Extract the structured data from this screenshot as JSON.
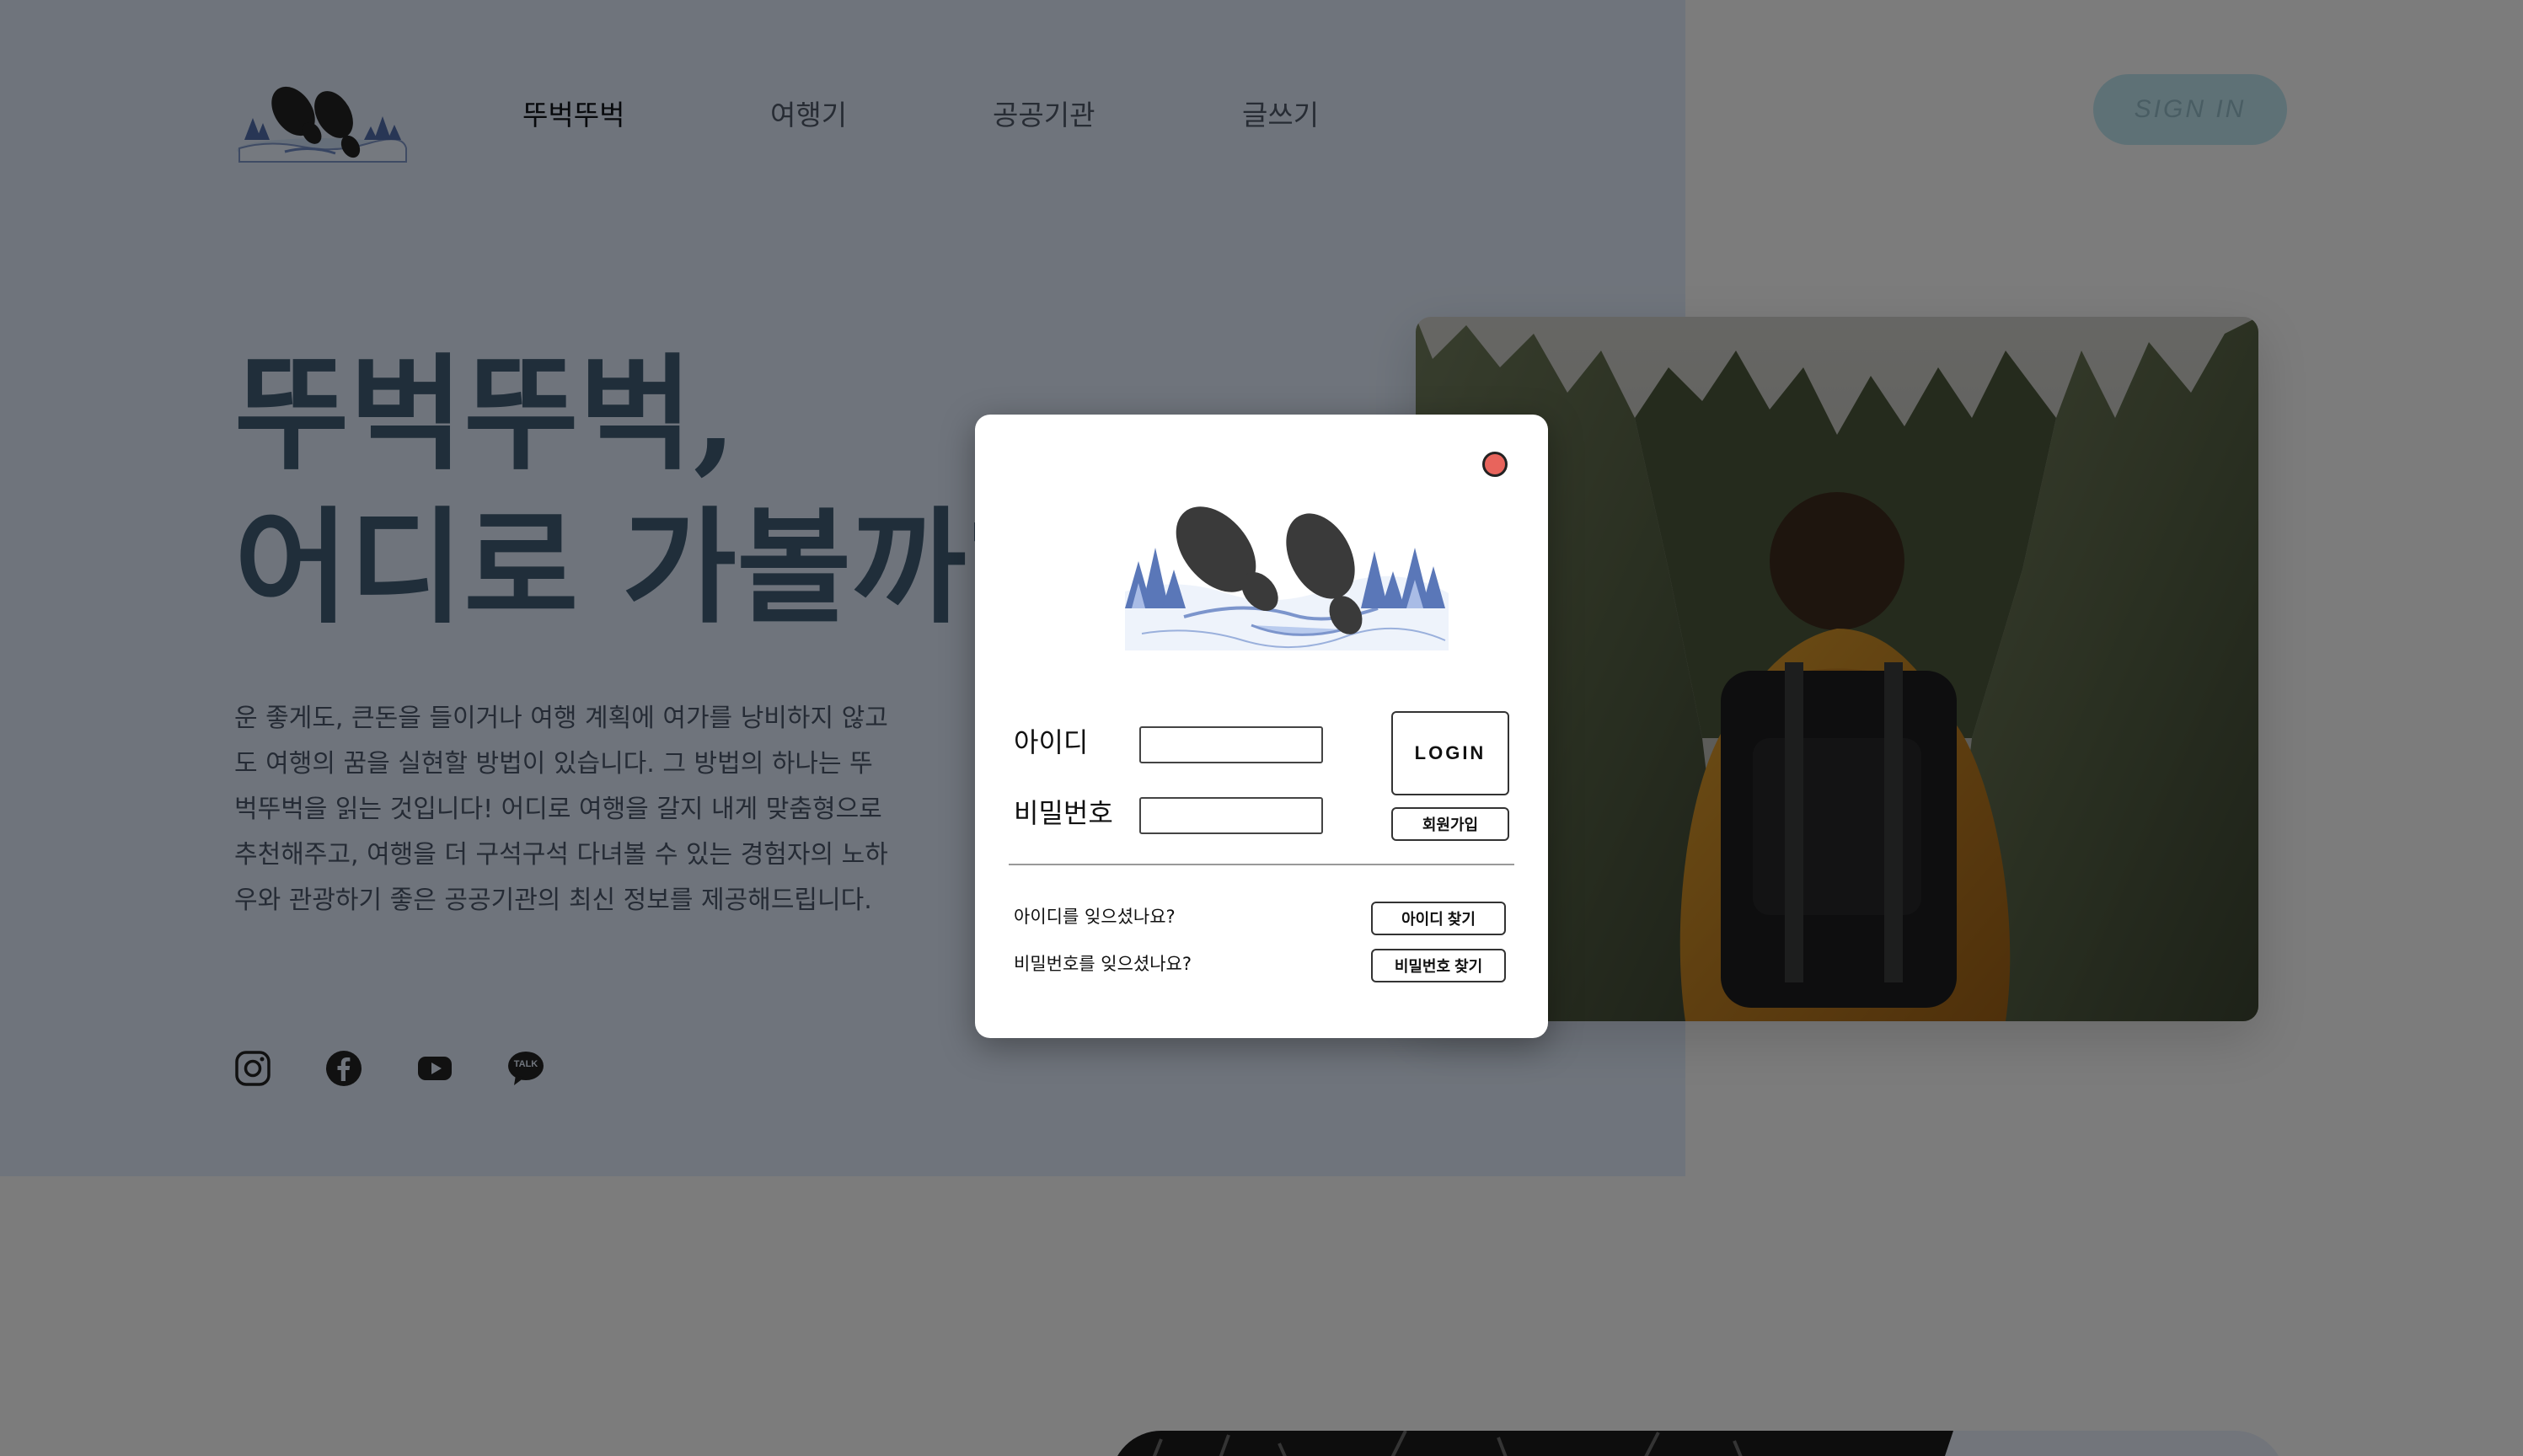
{
  "header": {
    "nav": [
      {
        "label": "뚜벅뚜벅"
      },
      {
        "label": "여행기"
      },
      {
        "label": "공공기관"
      },
      {
        "label": "글쓰기"
      }
    ],
    "signin_label": "SIGN IN"
  },
  "hero": {
    "title_line1": "뚜벅뚜벅,",
    "title_line2": "어디로 가볼까?",
    "description": [
      "운 좋게도, 큰돈을 들이거나 여행 계획에 여가를 낭비하지 않고",
      "도 여행의 꿈을 실현할 방법이 있습니다. 그 방법의 하나는 뚜",
      "벅뚜벅을 읽는 것입니다! 어디로 여행을 갈지 내게 맞춤형으로",
      "추천해주고, 여행을 더 구석구석 다녀볼 수 있는 경험자의 노하",
      "우와 관광하기 좋은 공공기관의 최신 정보를 제공해드립니다."
    ]
  },
  "social": {
    "kakao_label": "TALK"
  },
  "modal": {
    "id_label": "아이디",
    "password_label": "비밀번호",
    "id_value": "",
    "password_value": "",
    "login_label": "LOGIN",
    "signup_label": "회원가입",
    "forgot_id_text": "아이디를 잊으셨나요?",
    "find_id_label": "아이디 찾기",
    "forgot_pw_text": "비밀번호를 잊으셨나요?",
    "find_pw_label": "비밀번호 찾기"
  },
  "colors": {
    "hero_bg": "#dae4f3",
    "title": "#3f5a73",
    "signin_bg": "#b9dde8",
    "close_button": "#e8645c"
  }
}
